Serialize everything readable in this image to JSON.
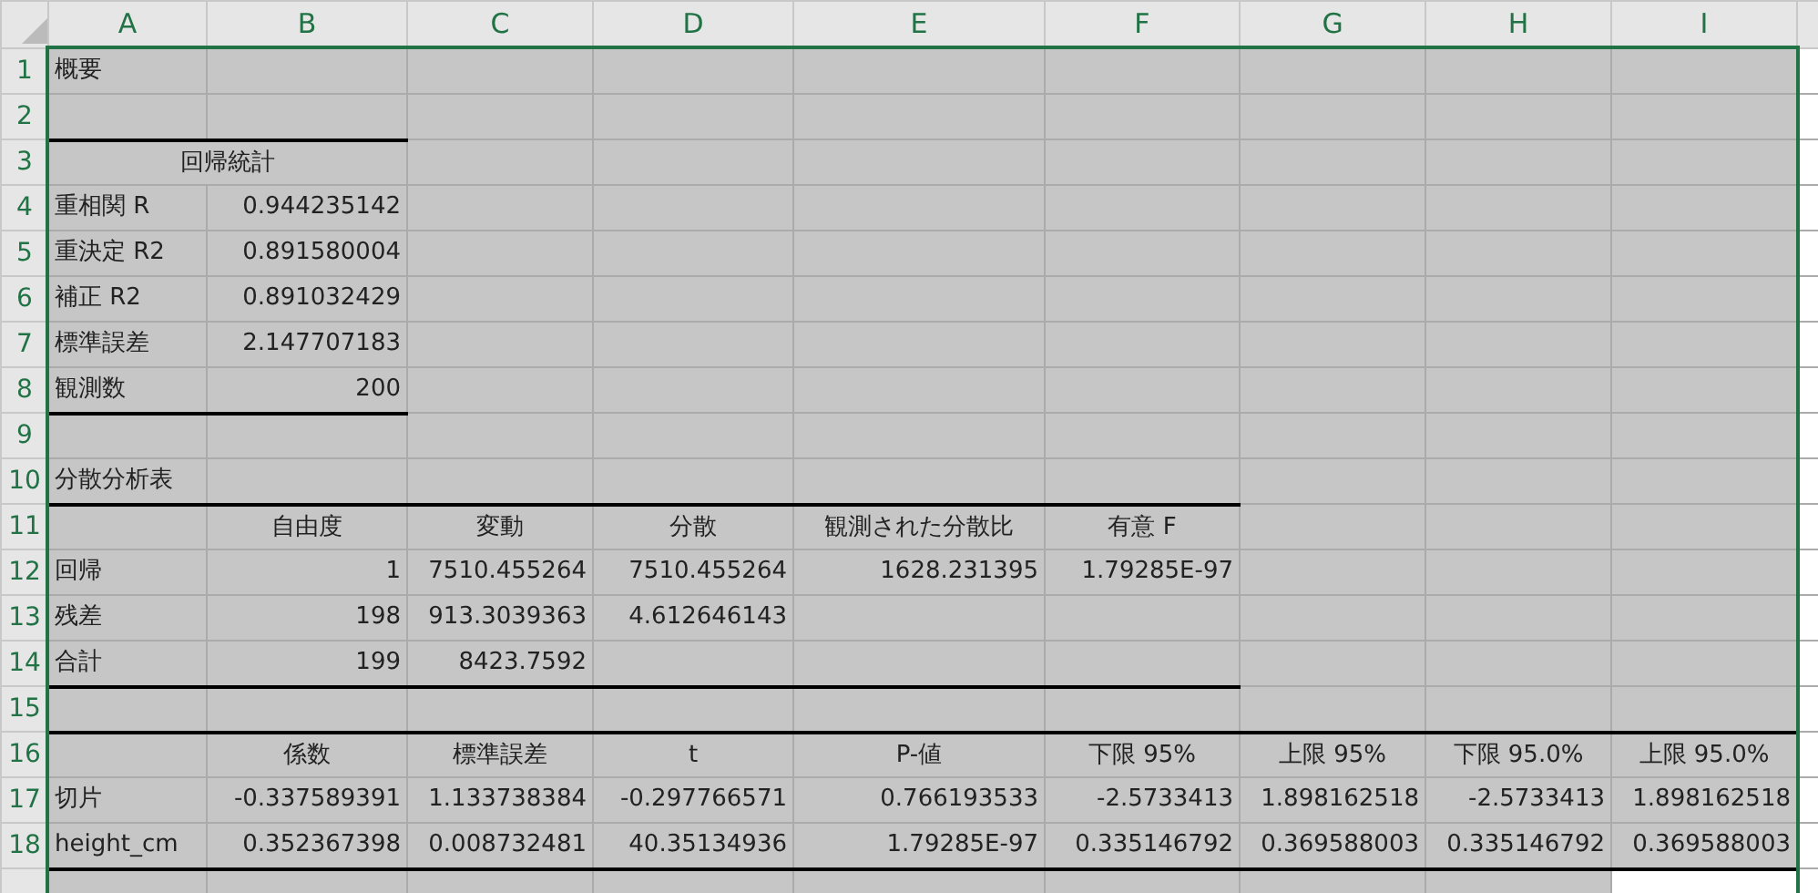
{
  "sheet": {
    "selected": true,
    "columns": [
      "A",
      "B",
      "C",
      "D",
      "E",
      "F",
      "G",
      "H",
      "I"
    ],
    "rows": [
      {
        "number": "1",
        "kind": "plain",
        "cells": [
          "概要",
          null,
          null,
          null,
          null,
          null,
          null,
          null,
          null
        ]
      },
      {
        "number": "2",
        "kind": "plain",
        "cells": [
          null,
          null,
          null,
          null,
          null,
          null,
          null,
          null,
          null
        ]
      },
      {
        "number": "3",
        "kind": "title",
        "cells": [
          {
            "text": "回帰統計",
            "colspan": 2
          },
          null,
          null,
          null,
          null,
          null,
          null,
          null
        ]
      },
      {
        "number": "4",
        "kind": "plain",
        "cells": [
          "重相関 R",
          "0.944235142",
          null,
          null,
          null,
          null,
          null,
          null,
          null
        ]
      },
      {
        "number": "5",
        "kind": "plain",
        "cells": [
          "重決定 R2",
          "0.891580004",
          null,
          null,
          null,
          null,
          null,
          null,
          null
        ]
      },
      {
        "number": "6",
        "kind": "plain",
        "cells": [
          "補正 R2",
          "0.891032429",
          null,
          null,
          null,
          null,
          null,
          null,
          null
        ]
      },
      {
        "number": "7",
        "kind": "plain",
        "cells": [
          "標準誤差",
          "2.147707183",
          null,
          null,
          null,
          null,
          null,
          null,
          null
        ]
      },
      {
        "number": "8",
        "kind": "plain",
        "cells": [
          "観測数",
          "200",
          null,
          null,
          null,
          null,
          null,
          null,
          null
        ]
      },
      {
        "number": "9",
        "kind": "plain",
        "cells": [
          null,
          null,
          null,
          null,
          null,
          null,
          null,
          null,
          null
        ]
      },
      {
        "number": "10",
        "kind": "plain",
        "cells": [
          "分散分析表",
          null,
          null,
          null,
          null,
          null,
          null,
          null,
          null
        ]
      },
      {
        "number": "11",
        "kind": "header",
        "cells": [
          null,
          "自由度",
          "変動",
          "分散",
          "観測された分散比",
          "有意 F",
          null,
          null,
          null
        ]
      },
      {
        "number": "12",
        "kind": "plain",
        "cells": [
          "回帰",
          "1",
          "7510.455264",
          "7510.455264",
          "1628.231395",
          "1.79285E-97",
          null,
          null,
          null
        ]
      },
      {
        "number": "13",
        "kind": "plain",
        "cells": [
          "残差",
          "198",
          "913.3039363",
          "4.612646143",
          null,
          null,
          null,
          null,
          null
        ]
      },
      {
        "number": "14",
        "kind": "plain",
        "cells": [
          "合計",
          "199",
          "8423.7592",
          null,
          null,
          null,
          null,
          null,
          null
        ]
      },
      {
        "number": "15",
        "kind": "plain",
        "cells": [
          null,
          null,
          null,
          null,
          null,
          null,
          null,
          null,
          null
        ]
      },
      {
        "number": "16",
        "kind": "header",
        "cells": [
          null,
          "係数",
          "標準誤差",
          "t",
          "P-値",
          "下限 95%",
          "上限 95%",
          "下限 95.0%",
          "上限 95.0%"
        ]
      },
      {
        "number": "17",
        "kind": "plain",
        "cells": [
          "切片",
          "-0.337589391",
          "1.133738384",
          "-0.297766571",
          "0.766193533",
          "-2.5733413",
          "1.898162518",
          "-2.5733413",
          "1.898162518"
        ]
      },
      {
        "number": "18",
        "kind": "plain",
        "cells": [
          "height_cm",
          "0.352367398",
          "0.008732481",
          "40.35134936",
          "1.79285E-97",
          "0.335146792",
          "0.369588003",
          "0.335146792",
          "0.369588003"
        ]
      },
      {
        "kind": "plain",
        "cells": [
          null,
          null,
          null,
          null,
          null,
          null,
          null,
          null,
          null
        ]
      }
    ]
  }
}
